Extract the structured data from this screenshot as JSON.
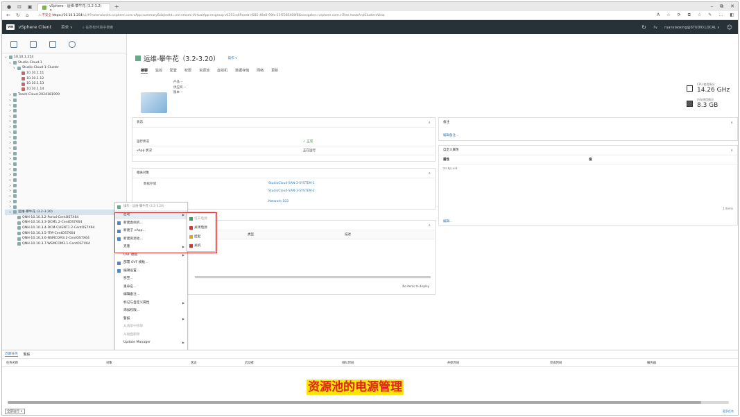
{
  "browser": {
    "tab_title": "vSphere - 运维-攀牛花 (3.2-3.2) ×",
    "new_tab": "+",
    "security": "⚠ 不安全",
    "url_host": "https://10.10.1.254",
    "url_rest": "/ui/#?extensionId=vsphere.core.vApp.summary&objectId=urn:vmomi:VirtualApp:resgroup-v1251:a69ceeb-d581-48d5-99fa-23f7285408f8&navigator=vsphere.core.viTree.hostsAndClustersView",
    "controls": [
      "–",
      "⧉",
      "✕"
    ],
    "right_icons": [
      "A",
      "☆",
      "⟳",
      "⧉",
      "☆",
      "✎",
      "…",
      "◧"
    ]
  },
  "vsphere": {
    "logo": "vm",
    "product": "vSphere Client",
    "menu": "菜单 ∨",
    "search_placeholder": "在所有环境中搜索",
    "user": "ruanxiaoxing@STUDIO.LOCAL ∨",
    "help": "?∨"
  },
  "sidebar": {
    "tree": [
      {
        "label": "10.10.1.254",
        "indent": 0,
        "caret": "∨"
      },
      {
        "label": "Studio-Cloud-1",
        "indent": 1,
        "caret": "∨"
      },
      {
        "label": "Studio-Cloud-1-Cluster",
        "indent": 2,
        "caret": "∨"
      },
      {
        "label": "10.10.1.11",
        "indent": 3,
        "caret": ""
      },
      {
        "label": "10.10.1.12",
        "indent": 3,
        "caret": ""
      },
      {
        "label": "10.10.1.13",
        "indent": 3,
        "caret": ""
      },
      {
        "label": "10.10.1.14",
        "indent": 3,
        "caret": ""
      },
      {
        "label": "Teach-Cloud-2024181999",
        "indent": 1,
        "caret": ">"
      },
      {
        "label": "",
        "indent": 1,
        "caret": ">"
      },
      {
        "label": "",
        "indent": 1,
        "caret": ">"
      },
      {
        "label": "",
        "indent": 1,
        "caret": ">"
      },
      {
        "label": "",
        "indent": 1,
        "caret": ">"
      },
      {
        "label": "",
        "indent": 1,
        "caret": ">"
      },
      {
        "label": "",
        "indent": 1,
        "caret": ">"
      },
      {
        "label": "",
        "indent": 1,
        "caret": ">"
      },
      {
        "label": "",
        "indent": 1,
        "caret": ">"
      },
      {
        "label": "",
        "indent": 1,
        "caret": ">"
      },
      {
        "label": "",
        "indent": 1,
        "caret": ">"
      },
      {
        "label": "",
        "indent": 1,
        "caret": ">"
      },
      {
        "label": "",
        "indent": 1,
        "caret": ">"
      },
      {
        "label": "",
        "indent": 1,
        "caret": ">"
      },
      {
        "label": "",
        "indent": 1,
        "caret": ">"
      },
      {
        "label": "",
        "indent": 1,
        "caret": ">"
      },
      {
        "label": "",
        "indent": 1,
        "caret": ">"
      },
      {
        "label": "",
        "indent": 1,
        "caret": ">"
      },
      {
        "label": "",
        "indent": 1,
        "caret": ">"
      },
      {
        "label": "",
        "indent": 1,
        "caret": ">"
      },
      {
        "label": "",
        "indent": 1,
        "caret": ">"
      },
      {
        "label": "",
        "indent": 1,
        "caret": ">"
      },
      {
        "label": "运维-攀牛花 (3.2-3.20)",
        "indent": 1,
        "caret": "∨",
        "selected": true
      },
      {
        "label": "QNH-10.10.3.2-Portal-CentOS7X64",
        "indent": 2,
        "caret": ""
      },
      {
        "label": "QNH-10.10.3.3-DCM1.2-CentOS7X64",
        "indent": 2,
        "caret": ""
      },
      {
        "label": "QNH-10.10.3.4-DCM-CLIENT1.2-CentOS7X64",
        "indent": 2,
        "caret": ""
      },
      {
        "label": "QNH-10.10.3.5-ITM-CentOS7X64",
        "indent": 2,
        "caret": ""
      },
      {
        "label": "QNH-10.10.3.6-NSMCOM3.2-CentOS7X64",
        "indent": 2,
        "caret": ""
      },
      {
        "label": "QNH-10.10.3.7-WSMCOM3.1-CentOS7X64",
        "indent": 2,
        "caret": ""
      }
    ]
  },
  "main": {
    "title": "运维-攀牛花（3.2-3.20）",
    "actions": "操作 ∨",
    "tabs": [
      "摘要",
      "监控",
      "配置",
      "权限",
      "资源池",
      "虚拟机",
      "数据存储",
      "网络",
      "更新"
    ],
    "summary_kv": [
      "产品 --",
      "供应商 --",
      "版本 --"
    ],
    "cpu_label": "CPU 使用情况",
    "cpu_value": "14.26 GHz",
    "mem_label": "内存使用情况",
    "mem_value": "8.3 GB"
  },
  "status_card": {
    "title": "状态",
    "rows": [
      [
        "运行状况",
        "✓ 正常"
      ],
      [
        "vApp 状况",
        "正在运行"
      ]
    ]
  },
  "related_card": {
    "title": "相关对象",
    "label": "数据存储",
    "datastores": [
      "StudioCloud-SAN-3-SYSTEM-1",
      "StudioCloud-SAN-3-SYSTEM-2"
    ],
    "network": "Network-103"
  },
  "table_card": {
    "headers": [
      "类型",
      "描述"
    ],
    "empty": "No items to display"
  },
  "notes_card": {
    "title": "备注",
    "edit": "编辑备注..."
  },
  "custom_card": {
    "title": "自定义属性",
    "headers": [
      "属性",
      "值"
    ],
    "row1": "zn.kp.uid",
    "items": "1 items",
    "edit": "编辑..."
  },
  "context_menu": {
    "header": "操作 - 运维-攀牛花 (3.2-3.20)",
    "items": [
      {
        "label": "启动",
        "arrow": true
      },
      {
        "label": "新建虚拟机...",
        "arrow": false
      },
      {
        "label": "新建子 vApp...",
        "arrow": false
      },
      {
        "label": "新建资源池...",
        "arrow": false
      },
      {
        "label": "克隆",
        "arrow": true
      },
      {
        "label": "OVF 模板",
        "arrow": true
      },
      {
        "label": "部署 OVF 模板...",
        "arrow": false
      },
      {
        "label": "编辑设置...",
        "arrow": false
      },
      {
        "label": "移至...",
        "arrow": false
      },
      {
        "label": "重命名...",
        "arrow": false
      },
      {
        "label": "编辑备注...",
        "arrow": false
      },
      {
        "label": "标记与自定义属性",
        "arrow": true
      },
      {
        "label": "添加权限...",
        "arrow": false
      },
      {
        "label": "警报",
        "arrow": true
      },
      {
        "label": "从清单中移除",
        "arrow": false,
        "disabled": true
      },
      {
        "label": "从磁盘删除",
        "arrow": false,
        "disabled": true
      },
      {
        "label": "Update Manager",
        "arrow": true
      }
    ]
  },
  "power_submenu": {
    "items": [
      "打开电源",
      "关闭电源",
      "挂起",
      "关机"
    ],
    "colors": [
      "#3aa04a",
      "#d63131",
      "#e6a11b",
      "#d63131"
    ]
  },
  "tasks": {
    "tabs": [
      "近期任务",
      "警报"
    ],
    "columns": [
      "任务名称",
      "对象",
      "状态",
      "启动者",
      "排队时间",
      "开始时间",
      "完成时间",
      "服务器"
    ]
  },
  "footer": {
    "caption": "资源池的电源管理",
    "status_select": "全部运行 ∨",
    "more": "更多任务"
  }
}
